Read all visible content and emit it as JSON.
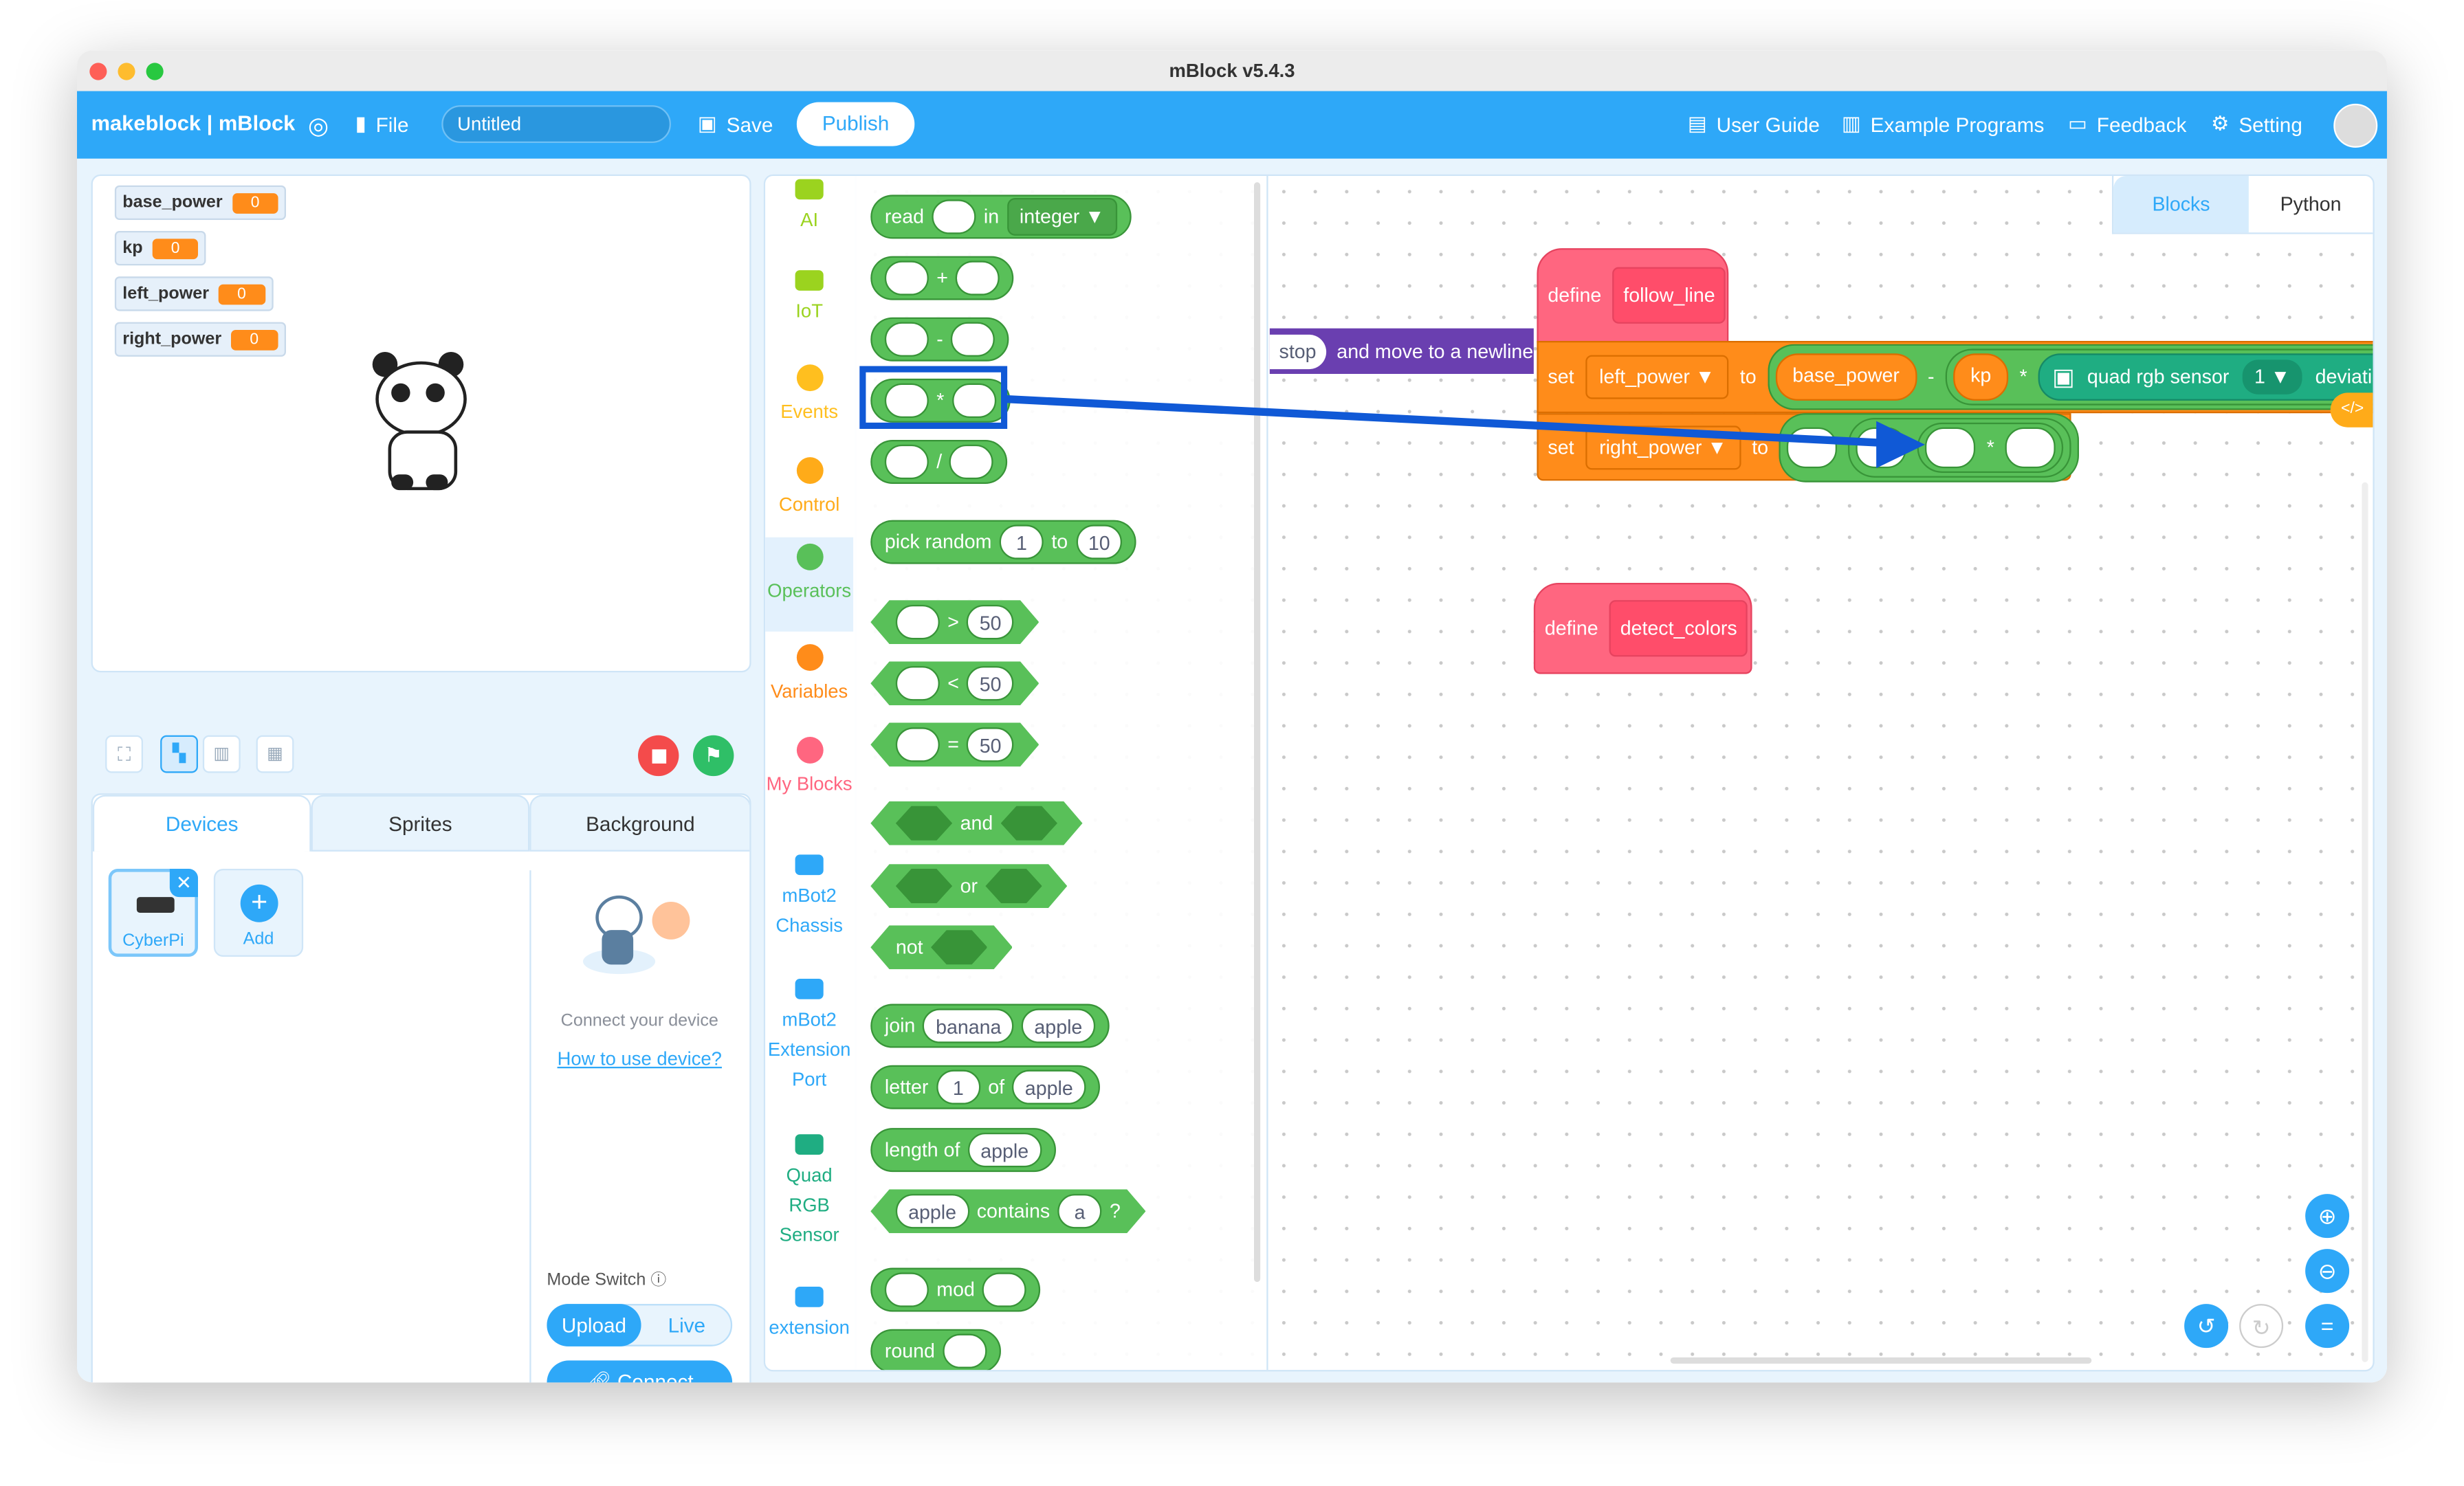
{
  "window": {
    "title": "mBlock v5.4.3"
  },
  "topbar": {
    "logo": "makeblock | mBlock",
    "file_label": "File",
    "project_name": "Untitled",
    "save_label": "Save",
    "publish_label": "Publish",
    "user_guide": "User Guide",
    "example_programs": "Example Programs",
    "feedback": "Feedback",
    "setting": "Setting"
  },
  "stage": {
    "variables": [
      {
        "name": "base_power",
        "value": "0"
      },
      {
        "name": "kp",
        "value": "0"
      },
      {
        "name": "left_power",
        "value": "0"
      },
      {
        "name": "right_power",
        "value": "0"
      }
    ]
  },
  "lower_tabs": [
    "Devices",
    "Sprites",
    "Background"
  ],
  "devices": {
    "items": [
      {
        "label": "CyberPi"
      },
      {
        "label": "Add"
      }
    ],
    "connect_text": "Connect your device",
    "how_to_link": "How to use device?",
    "mode_switch_label": "Mode Switch",
    "mode_upload": "Upload",
    "mode_live": "Live",
    "connect_button": "Connect"
  },
  "categories": [
    {
      "label": "AI",
      "color": "#9bd31f",
      "icon": "ai-icon"
    },
    {
      "label": "IoT",
      "color": "#9bd31f",
      "icon": "iot-icon"
    },
    {
      "label": "Events",
      "color": "#ffbf1f",
      "icon": "events-dot"
    },
    {
      "label": "Control",
      "color": "#ffab19",
      "icon": "control-dot"
    },
    {
      "label": "Operators",
      "color": "#59c059",
      "icon": "operators-dot",
      "selected": true
    },
    {
      "label": "Variables",
      "color": "#ff8c1a",
      "icon": "variables-dot"
    },
    {
      "label": "My Blocks",
      "color": "#ff6680",
      "icon": "myblocks-dot"
    },
    {
      "label": "mBot2 Chassis",
      "color": "#2ea8f8",
      "icon": "mbot2-chassis-icon"
    },
    {
      "label": "mBot2 Extension Port",
      "color": "#2ea8f8",
      "icon": "mbot2-extension-icon"
    },
    {
      "label": "Quad RGB Sensor",
      "color": "#1fad82",
      "icon": "quad-rgb-icon"
    },
    {
      "label": "extension",
      "color": "#2ea8f8",
      "icon": "extension-plus-icon"
    }
  ],
  "palette": [
    {
      "shape": "round",
      "parts": [
        [
          "t",
          "read"
        ],
        [
          "s",
          ""
        ],
        [
          "t",
          "in"
        ],
        [
          "d",
          "integer ▼"
        ]
      ]
    },
    {
      "shape": "round",
      "parts": [
        [
          "s",
          ""
        ],
        [
          "t",
          "+"
        ],
        [
          "s",
          ""
        ]
      ]
    },
    {
      "shape": "round",
      "parts": [
        [
          "s",
          ""
        ],
        [
          "t",
          "-"
        ],
        [
          "s",
          ""
        ]
      ]
    },
    {
      "shape": "round",
      "parts": [
        [
          "s",
          ""
        ],
        [
          "t",
          "*"
        ],
        [
          "s",
          ""
        ]
      ],
      "highlighted": true
    },
    {
      "shape": "round",
      "parts": [
        [
          "s",
          ""
        ],
        [
          "t",
          "/"
        ],
        [
          "s",
          ""
        ]
      ]
    },
    {
      "shape": "round",
      "parts": [
        [
          "t",
          "pick random"
        ],
        [
          "s",
          "1"
        ],
        [
          "t",
          "to"
        ],
        [
          "s",
          "10"
        ]
      ]
    },
    {
      "shape": "hex",
      "parts": [
        [
          "s",
          ""
        ],
        [
          "t",
          ">"
        ],
        [
          "s",
          "50"
        ]
      ]
    },
    {
      "shape": "hex",
      "parts": [
        [
          "s",
          ""
        ],
        [
          "t",
          "<"
        ],
        [
          "s",
          "50"
        ]
      ]
    },
    {
      "shape": "hex",
      "parts": [
        [
          "s",
          ""
        ],
        [
          "t",
          "="
        ],
        [
          "s",
          "50"
        ]
      ]
    },
    {
      "shape": "hex",
      "parts": [
        [
          "h",
          ""
        ],
        [
          "t",
          "and"
        ],
        [
          "h",
          ""
        ]
      ]
    },
    {
      "shape": "hex",
      "parts": [
        [
          "h",
          ""
        ],
        [
          "t",
          "or"
        ],
        [
          "h",
          ""
        ]
      ]
    },
    {
      "shape": "hex",
      "parts": [
        [
          "t",
          "not"
        ],
        [
          "h",
          ""
        ]
      ]
    },
    {
      "shape": "round",
      "parts": [
        [
          "t",
          "join"
        ],
        [
          "s",
          "banana"
        ],
        [
          "s",
          "apple"
        ]
      ]
    },
    {
      "shape": "round",
      "parts": [
        [
          "t",
          "letter"
        ],
        [
          "s",
          "1"
        ],
        [
          "t",
          "of"
        ],
        [
          "s",
          "apple"
        ]
      ]
    },
    {
      "shape": "round",
      "parts": [
        [
          "t",
          "length of"
        ],
        [
          "s",
          "apple"
        ]
      ]
    },
    {
      "shape": "hex",
      "parts": [
        [
          "s",
          "apple"
        ],
        [
          "t",
          "contains"
        ],
        [
          "s",
          "a"
        ],
        [
          "t",
          "?"
        ]
      ]
    },
    {
      "shape": "round",
      "parts": [
        [
          "s",
          ""
        ],
        [
          "t",
          "mod"
        ],
        [
          "s",
          ""
        ]
      ]
    },
    {
      "shape": "round",
      "parts": [
        [
          "t",
          "round"
        ],
        [
          "s",
          ""
        ]
      ]
    }
  ],
  "workspace": {
    "tabs": [
      "Blocks",
      "Python"
    ],
    "purple_block": {
      "value": "stop",
      "text": "and move to a newline"
    },
    "define1": {
      "keyword": "define",
      "name": "follow_line"
    },
    "set1": {
      "keyword": "set",
      "variable": "left_power ▼",
      "to": "to",
      "a": "base_power",
      "minus": "-",
      "b": "kp",
      "times": "*",
      "sensor": "quad rgb sensor",
      "sensor_index": "1 ▼",
      "sensor_value": "deviation"
    },
    "set2": {
      "keyword": "set",
      "variable": "right_power ▼",
      "to": "to",
      "times": "*"
    },
    "define2": {
      "keyword": "define",
      "name": "detect_colors"
    }
  },
  "colors": {
    "accent": "#2ea8f8",
    "operators": "#59c059",
    "variables": "#ff8c1a",
    "myblocks": "#ff6680",
    "annotation": "#1059d6"
  }
}
